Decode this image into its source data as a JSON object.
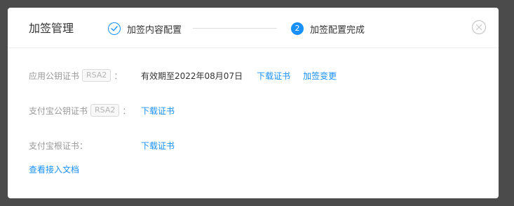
{
  "modal": {
    "title": "加签管理",
    "steps": [
      {
        "label": "加签内容配置",
        "status": "done",
        "icon": "check-icon"
      },
      {
        "number": "2",
        "label": "加签配置完成",
        "status": "active"
      }
    ],
    "close_icon": "close-circle-icon"
  },
  "rows": [
    {
      "label": "应用公钥证书",
      "badge": "RSA2",
      "colon": "：",
      "validity": "有效期至2022年08月07日",
      "links": [
        "下载证书",
        "加签变更"
      ]
    },
    {
      "label": "支付宝公钥证书",
      "badge": "RSA2",
      "colon": "：",
      "links": [
        "下载证书"
      ]
    },
    {
      "label": "支付宝根证书",
      "colon": "：",
      "links": [
        "下载证书"
      ]
    }
  ],
  "doc_link": "查看接入文档",
  "colors": {
    "accent": "#1890ff",
    "overlay": "#4b4b4b",
    "muted_text": "#999999",
    "primary_text": "#333333"
  }
}
